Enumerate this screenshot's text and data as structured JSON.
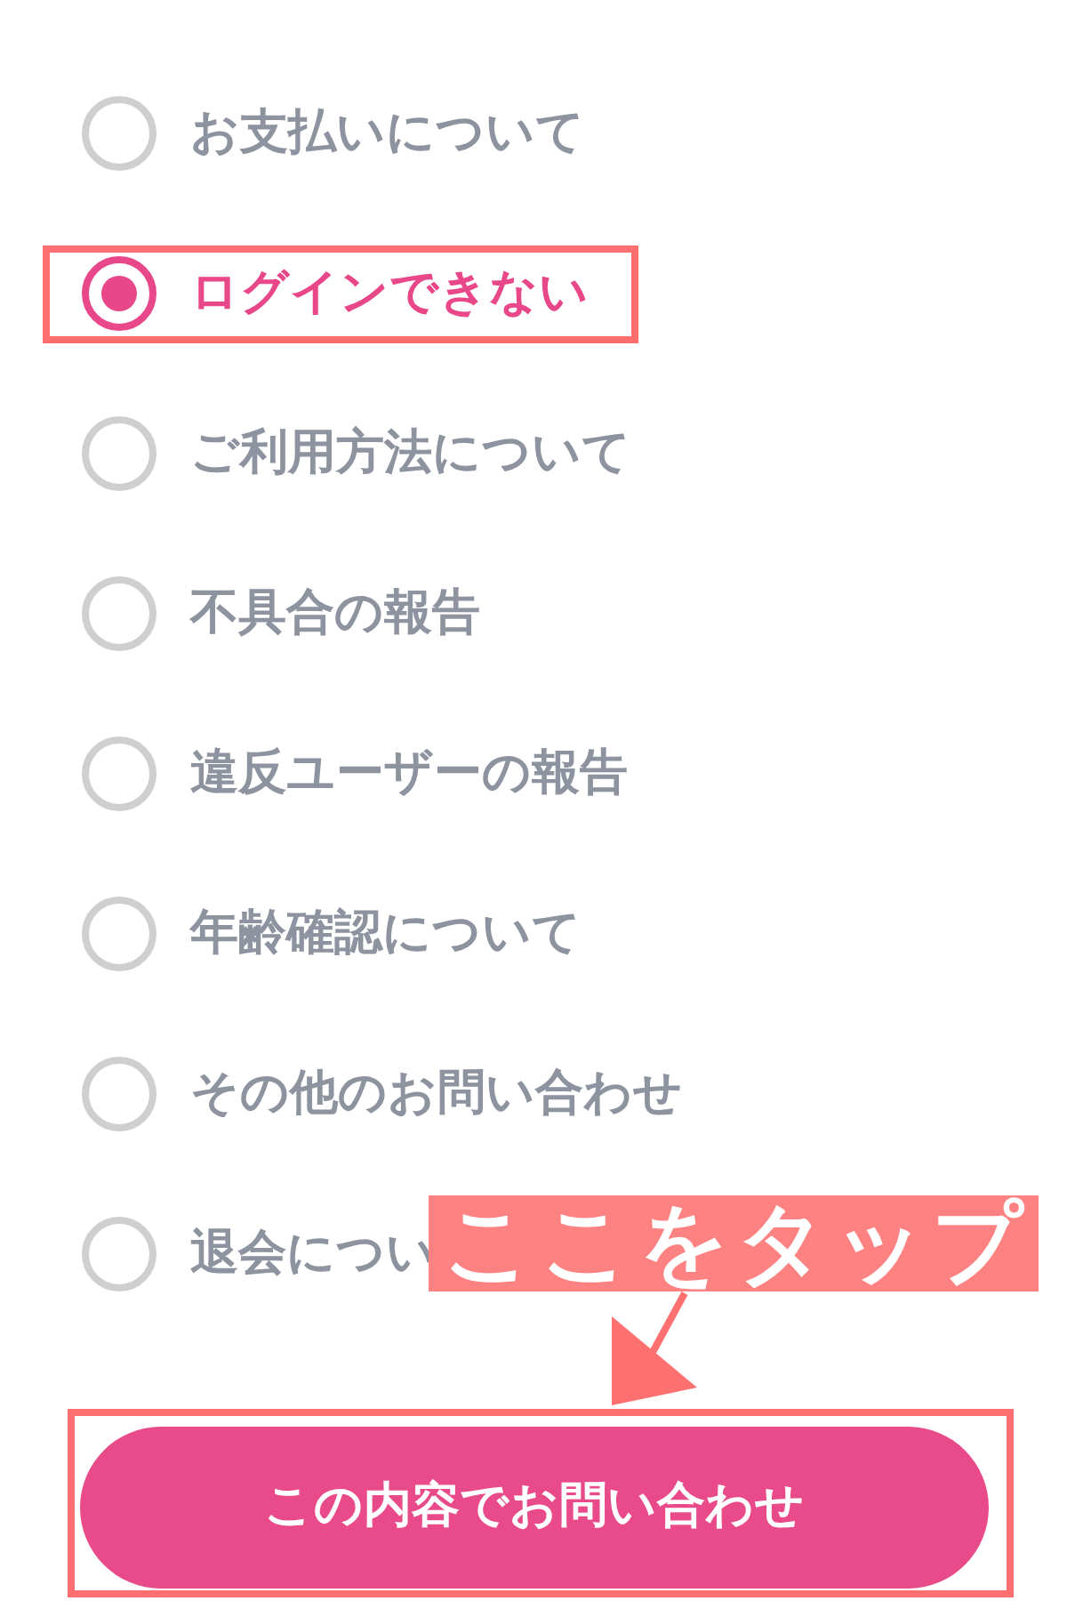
{
  "options": [
    {
      "label": "お支払いについて",
      "selected": false,
      "highlighted": false
    },
    {
      "label": "ログインできない",
      "selected": true,
      "highlighted": true
    },
    {
      "label": "ご利用方法について",
      "selected": false,
      "highlighted": false
    },
    {
      "label": "不具合の報告",
      "selected": false,
      "highlighted": false
    },
    {
      "label": "違反ユーザーの報告",
      "selected": false,
      "highlighted": false
    },
    {
      "label": "年齢確認について",
      "selected": false,
      "highlighted": false
    },
    {
      "label": "その他のお問い合わせ",
      "selected": false,
      "highlighted": false
    },
    {
      "label": "退会につい",
      "selected": false,
      "highlighted": false
    }
  ],
  "submit_button": {
    "label": "この内容でお問い合わせ",
    "highlighted": true
  },
  "callout": {
    "text": "ここをタップ"
  }
}
